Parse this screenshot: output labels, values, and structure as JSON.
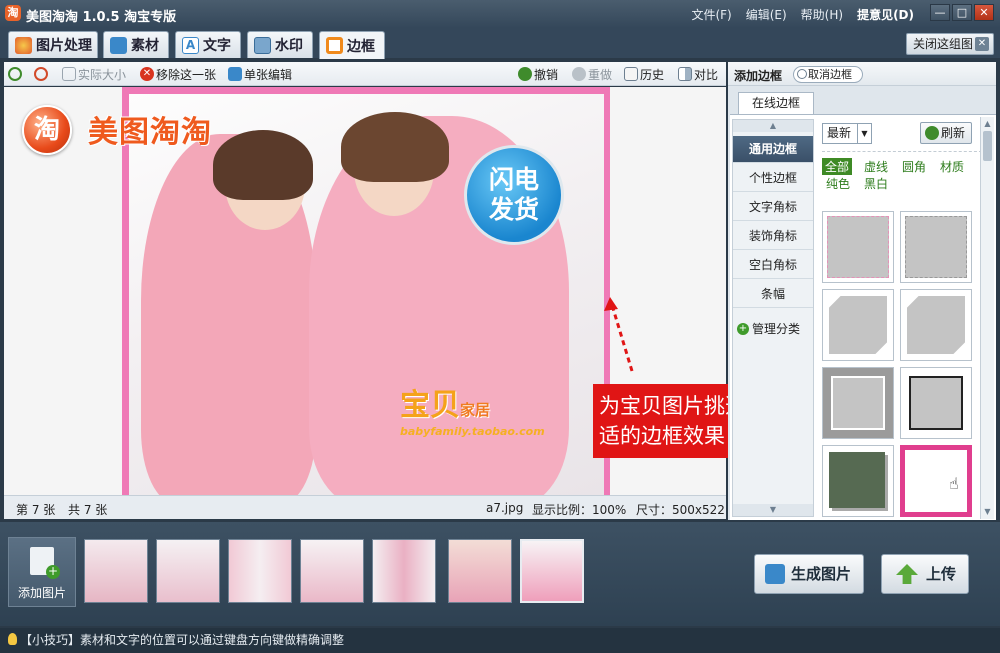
{
  "app": {
    "title": "美图淘淘 1.0.5 淘宝专版",
    "icon_text": "淘"
  },
  "menu": {
    "file": "文件(F)",
    "edit": "编辑(E)",
    "help": "帮助(H)",
    "feedback": "提意见(D)"
  },
  "window_controls": {
    "minimize": "—",
    "maximize": "□",
    "close": "✕"
  },
  "tabs": [
    {
      "label": "图片处理",
      "icon": "palette-icon",
      "color": "#e25c2c"
    },
    {
      "label": "素材",
      "icon": "image-icon",
      "color": "#3a88c9"
    },
    {
      "label": "文字",
      "icon": "text-icon",
      "color": "#3a88c9"
    },
    {
      "label": "水印",
      "icon": "watermark-icon",
      "color": "#3a88c9"
    },
    {
      "label": "边框",
      "icon": "frame-icon",
      "color": "#f08a1c"
    }
  ],
  "close_group": "关闭这组图",
  "toolbar": {
    "actual_size": "实际大小",
    "remove_one": "移除这一张",
    "single_edit": "单张编辑",
    "undo": "撤销",
    "redo": "重做",
    "history": "历史",
    "compare": "对比"
  },
  "canvas": {
    "brand_logo_text": "美图淘淘",
    "badge_text_line1": "闪电",
    "badge_text_line2": "发货",
    "shop_name": "宝贝",
    "shop_name_suffix": "家居",
    "shop_url": "babyfamily.taobao.com",
    "callout_line1": "为宝贝图片挑选合",
    "callout_line2": "适的边框效果"
  },
  "status": {
    "current": "第 7 张",
    "total": "共 7 张",
    "filename": "a7.jpg",
    "scale_label": "显示比例：100%",
    "size_label": "尺寸：500x522"
  },
  "right_panel": {
    "title": "添加边框",
    "cancel": "取消边框",
    "online_tab": "在线边框",
    "categories": [
      "通用边框",
      "个性边框",
      "文字角标",
      "装饰角标",
      "空白角标",
      "条幅"
    ],
    "manage": "管理分类",
    "sort_selected": "最新",
    "refresh": "刷新",
    "filters": [
      "全部",
      "虚线",
      "圆角",
      "材质",
      "纯色",
      "黑白"
    ]
  },
  "bottom": {
    "add_photo": "添加图片",
    "generate": "生成图片",
    "upload": "上传"
  },
  "tip": "【小技巧】素材和文字的位置可以通过键盘方向键做精确调整",
  "colors": {
    "accent_pink": "#e03e8e",
    "callout_red": "#e01515",
    "title_bar": "#34475a"
  }
}
